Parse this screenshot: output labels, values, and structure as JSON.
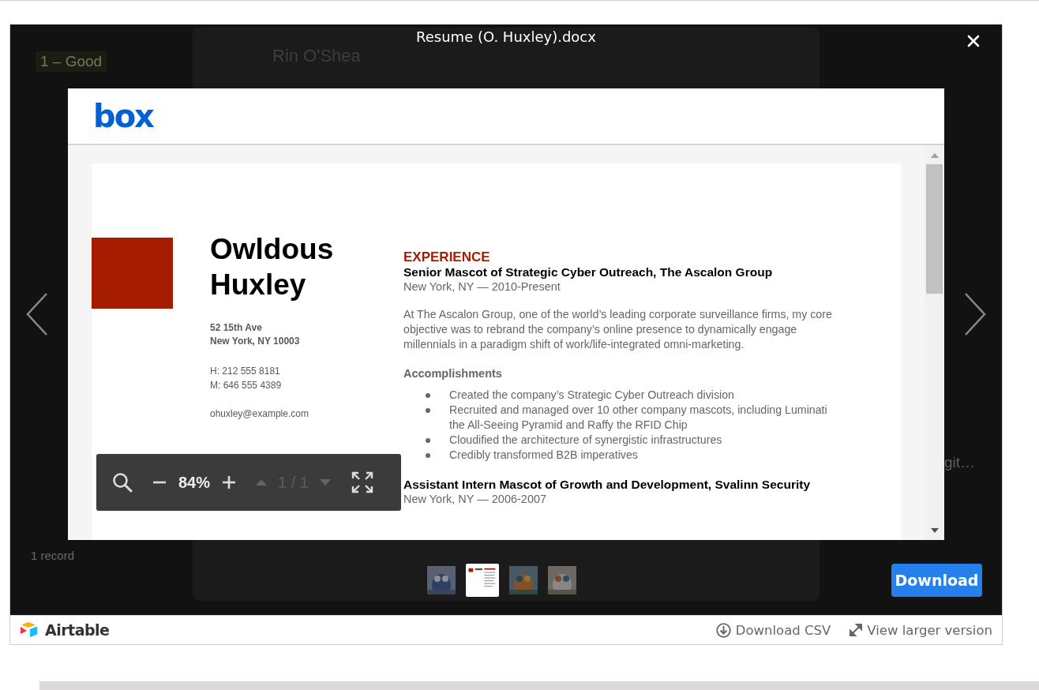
{
  "background": {
    "rating": "1 – Good",
    "record_name": "Rin O'Shea",
    "overflow_text": "git…",
    "record_count": "1 record"
  },
  "viewer": {
    "title": "Resume (O. Huxley).docx",
    "brand": "box",
    "document": {
      "name_lines": [
        "Owldous",
        "Huxley"
      ],
      "address": [
        "52 15th Ave",
        "New York, NY 10003"
      ],
      "phones": [
        "H: 212 555 8181",
        "M: 646 555 4389"
      ],
      "email": "ohuxley@example.com",
      "section_heading": "EXPERIENCE",
      "jobs": [
        {
          "title": "Senior Mascot of Strategic Cyber Outreach, The Ascalon Group",
          "meta": "New York, NY — 2010-Present",
          "summary": "At The Ascalon Group, one of the world’s leading corporate surveillance firms, my core objective was to rebrand the company’s online presence to dynamically engage millennials in a paradigm shift of work/life-integrated omni-marketing.",
          "subheading": "Accomplishments",
          "bullets": [
            "Created the company’s Strategic Cyber Outreach division",
            "Recruited and managed over 10 other company mascots, including Luminati the All-Seeing Pyramid and Raffy the RFID Chip",
            "Cloudified the architecture of synergistic infrastructures",
            "Credibly transformed B2B imperatives"
          ]
        },
        {
          "title": "Assistant Intern Mascot of Growth and Development, Svalinn Security",
          "meta": "New York, NY — 2006-2007"
        }
      ]
    },
    "toolbar": {
      "zoom": "84%",
      "page": "1 / 1",
      "page_nav_disabled": true
    },
    "thumbnails": [
      {
        "kind": "picture",
        "selected": false
      },
      {
        "kind": "document",
        "selected": true
      },
      {
        "kind": "picture",
        "selected": false
      },
      {
        "kind": "picture",
        "selected": false
      }
    ],
    "download": "Download"
  },
  "footer": {
    "brand": "Airtable",
    "links": [
      {
        "kind": "download",
        "label": "Download CSV"
      },
      {
        "kind": "expand",
        "label": "View larger version"
      }
    ]
  }
}
